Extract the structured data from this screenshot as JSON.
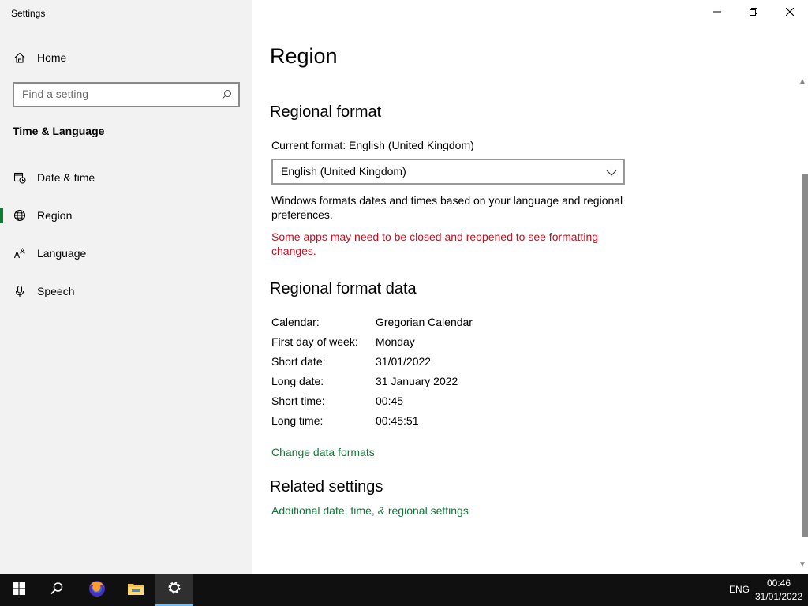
{
  "app_title": "Settings",
  "sidebar": {
    "home_label": "Home",
    "search_placeholder": "Find a setting",
    "section_title": "Time & Language",
    "items": [
      {
        "label": "Date & time",
        "icon": "calendar-clock-icon",
        "active": false
      },
      {
        "label": "Region",
        "icon": "globe-icon",
        "active": true
      },
      {
        "label": "Language",
        "icon": "language-icon",
        "active": false
      },
      {
        "label": "Speech",
        "icon": "microphone-icon",
        "active": false
      }
    ]
  },
  "window_controls": {
    "minimize": "minimize-icon",
    "restore": "restore-icon",
    "close": "close-icon"
  },
  "main": {
    "title": "Region",
    "regional_format": {
      "heading": "Regional format",
      "current_format": "Current format: English (United Kingdom)",
      "selected": "English (United Kingdom)",
      "description": "Windows formats dates and times based on your language and regional preferences.",
      "warning": "Some apps may need to be closed and reopened to see formatting changes."
    },
    "format_data": {
      "heading": "Regional format data",
      "rows": [
        {
          "label": "Calendar:",
          "value": "Gregorian Calendar"
        },
        {
          "label": "First day of week:",
          "value": "Monday"
        },
        {
          "label": "Short date:",
          "value": "31/01/2022"
        },
        {
          "label": "Long date:",
          "value": "31 January 2022"
        },
        {
          "label": "Short time:",
          "value": "00:45"
        },
        {
          "label": "Long time:",
          "value": "00:45:51"
        }
      ],
      "change_link": "Change data formats"
    },
    "related": {
      "heading": "Related settings",
      "link": "Additional date, time, & regional settings"
    }
  },
  "taskbar": {
    "language": "ENG",
    "time": "00:46",
    "date": "31/01/2022"
  },
  "colors": {
    "accent": "#0f7938",
    "warning": "#c50f1f",
    "sidebar_bg": "#f2f2f2",
    "taskbar_bg": "#101010"
  }
}
